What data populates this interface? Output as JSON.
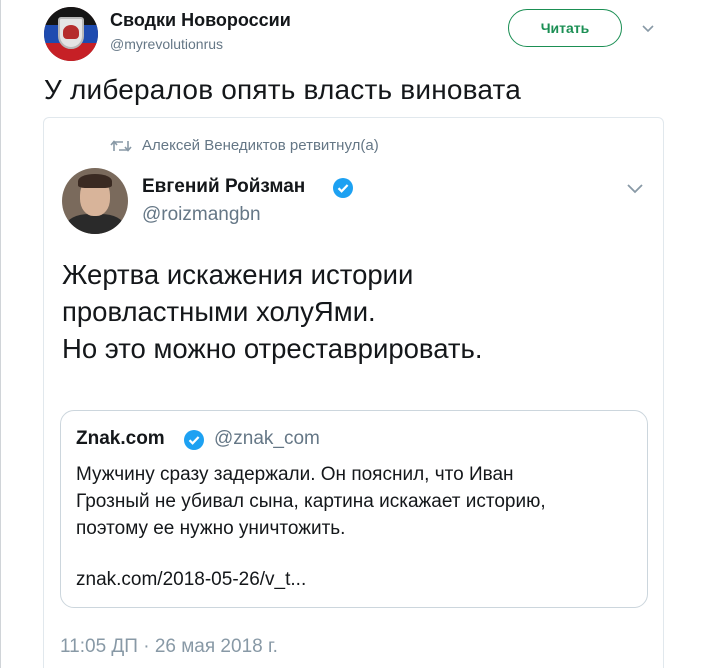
{
  "outer_tweet": {
    "author_name": "Сводки Новороссии",
    "author_handle": "@myrevolutionrus",
    "follow_label": "Читать",
    "text": "У либералов опять власть виновата"
  },
  "retweet": {
    "retweeted_by": "Алексей Венедиктов ретвитнул(а)",
    "author_name": "Евгений Ройзман",
    "author_handle": "@roizmangbn",
    "text_lines": [
      "Жертва  искажения истории",
      "провластными холуЯми.",
      "Но это можно отреставрировать."
    ],
    "timestamp": "11:05 ДП · 26 мая 2018 г."
  },
  "quoted": {
    "author_name": "Znak.com",
    "author_handle": "@znak_com",
    "text_lines": [
      "Мужчину сразу задержали. Он пояснил, что Иван",
      "Грозный не убивал сына, картина искажает историю,",
      "поэтому ее нужно уничтожить."
    ],
    "link": "znak.com/2018-05-26/v_t..."
  },
  "colors": {
    "accent_green": "#1b8f54",
    "verified_blue": "#1da1f2",
    "muted_text": "#657786"
  },
  "icons": [
    "retweet-icon",
    "verified-badge-icon",
    "chevron-down-icon"
  ]
}
